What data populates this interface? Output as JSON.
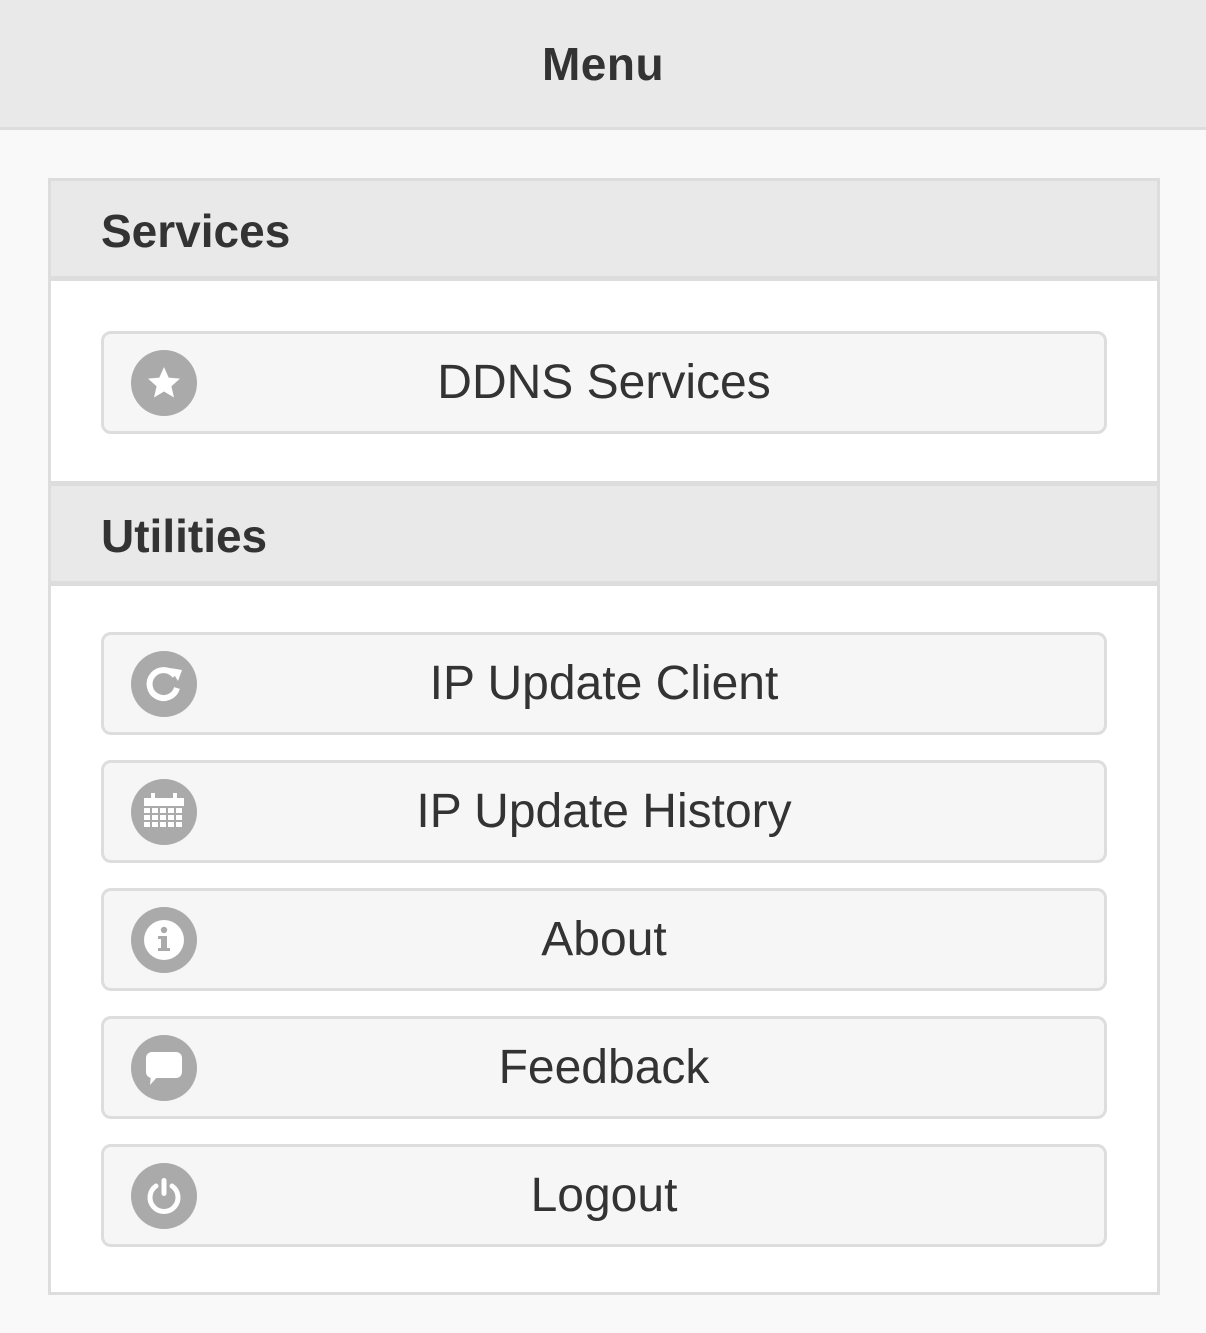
{
  "header": {
    "title": "Menu"
  },
  "sections": [
    {
      "title": "Services",
      "items": [
        {
          "label": "DDNS Services",
          "icon": "star-icon"
        }
      ]
    },
    {
      "title": "Utilities",
      "items": [
        {
          "label": "IP Update Client",
          "icon": "refresh-icon"
        },
        {
          "label": "IP Update History",
          "icon": "calendar-icon"
        },
        {
          "label": "About",
          "icon": "info-icon"
        },
        {
          "label": "Feedback",
          "icon": "comment-icon"
        },
        {
          "label": "Logout",
          "icon": "power-icon"
        }
      ]
    }
  ],
  "colors": {
    "header_bg": "#e9e9e9",
    "page_bg": "#f9f9f9",
    "button_bg": "#f6f6f6",
    "border": "#dddddd",
    "icon_bg": "#aaaaaa",
    "text": "#333333"
  }
}
